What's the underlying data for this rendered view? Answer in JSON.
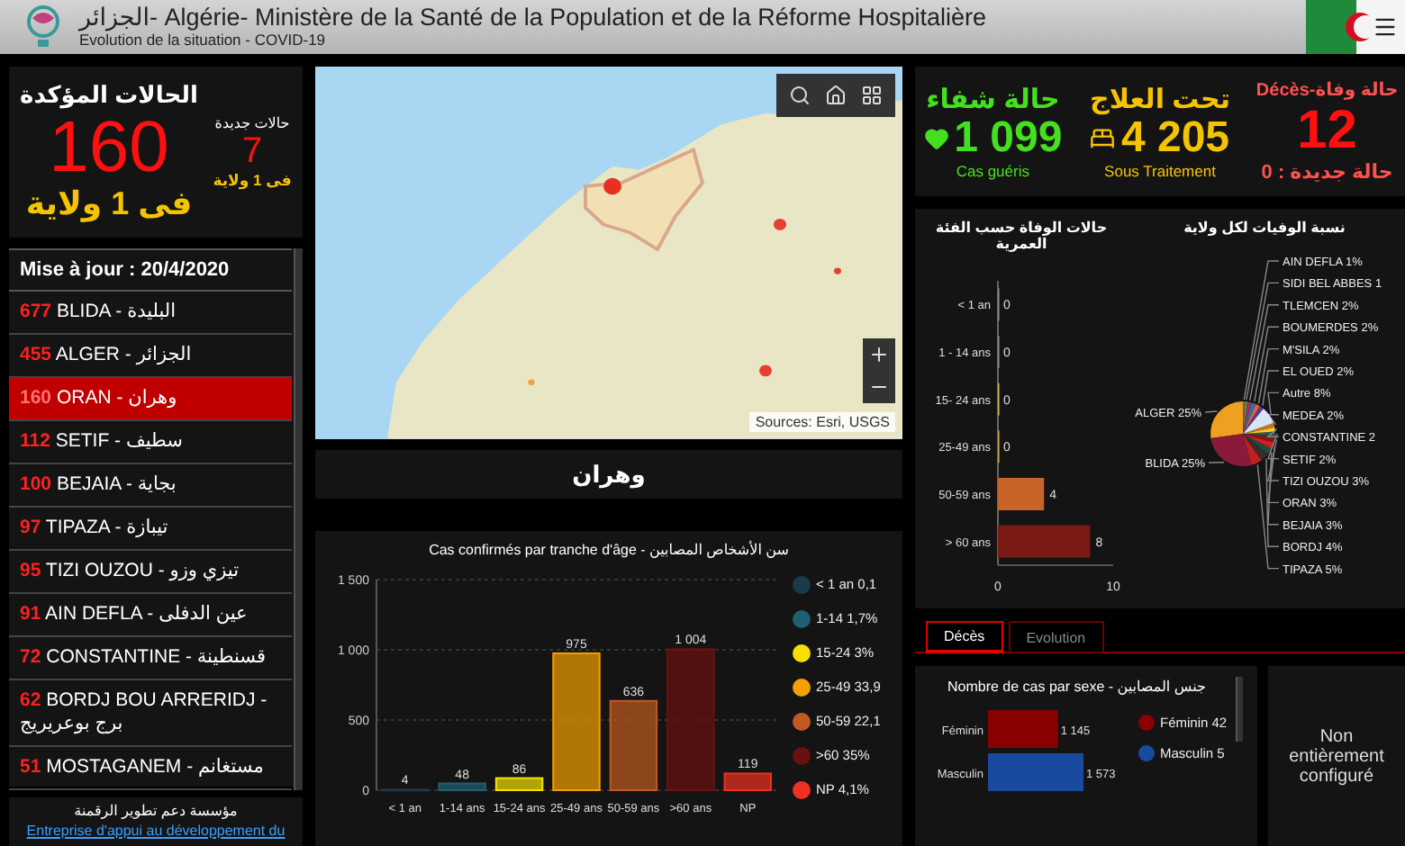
{
  "header": {
    "title": "الجزائر- Algérie- Ministère de la Santé de la Population et de la Réforme Hospitalière",
    "subtitle": "Evolution de la situation - COVID-19"
  },
  "confirmed": {
    "title": "الحالات المؤكدة",
    "value": "160",
    "region": "فى 1 ولاية",
    "new_label": "حالات جديدة",
    "new_value": "7",
    "new_region": "فى 1 ولاية"
  },
  "wilaya_list": {
    "header": "Mise à jour : 20/4/2020",
    "items": [
      {
        "count": "677",
        "name": "BLIDA -",
        "name_ar": "البليدة",
        "selected": false
      },
      {
        "count": "455",
        "name": "ALGER -",
        "name_ar": "الجزائر",
        "selected": false
      },
      {
        "count": "160",
        "name": "ORAN -",
        "name_ar": "وهران",
        "selected": true
      },
      {
        "count": "112",
        "name": "SETIF -",
        "name_ar": "سطيف",
        "selected": false
      },
      {
        "count": "100",
        "name": "BEJAIA -",
        "name_ar": "بجاية",
        "selected": false
      },
      {
        "count": "97",
        "name": "TIPAZA -",
        "name_ar": "تيبازة",
        "selected": false
      },
      {
        "count": "95",
        "name": "TIZI OUZOU -",
        "name_ar": "تيزي وزو",
        "selected": false
      },
      {
        "count": "91",
        "name": "AIN DEFLA -",
        "name_ar": "عين الدفلى",
        "selected": false
      },
      {
        "count": "72",
        "name": "CONSTANTINE -",
        "name_ar": "قسنطينة",
        "selected": false
      },
      {
        "count": "62",
        "name": "BORDJ BOU ARRERIDJ -",
        "name_ar": "برج بوعريريج",
        "selected": false
      },
      {
        "count": "51",
        "name": "MOSTAGANEM -",
        "name_ar": "مستغانم",
        "selected": false
      }
    ]
  },
  "footer": {
    "title": "مؤسسة دعم تطوير الرقمنة",
    "link": "Entreprise d'appui au développement du"
  },
  "map": {
    "source": "Sources: Esri, USGS",
    "caption": "وهران"
  },
  "age_chart": {
    "title": "Cas confirmés par tranche d'âge - سن الأشخاص المصابين",
    "chart_data": {
      "type": "bar",
      "categories": [
        "< 1 an",
        "1-14 ans",
        "15-24 ans",
        "25-49 ans",
        "50-59 ans",
        ">60 ans",
        "NP"
      ],
      "values": [
        4,
        48,
        86,
        975,
        636,
        1004,
        119
      ],
      "ylim": [
        0,
        1500
      ],
      "yticks": [
        0,
        500,
        {
          "value": 1000,
          "label": "1 000"
        },
        {
          "value": 1500,
          "label": "1 500"
        }
      ],
      "value_labels": [
        "4",
        "48",
        "86",
        "975",
        "636",
        "1 004",
        "119"
      ]
    },
    "legend": [
      {
        "label": "< 1 an 0,1",
        "color": "#1b3a4b"
      },
      {
        "label": "1-14 1,7%",
        "color": "#1e6070"
      },
      {
        "label": "15-24 3%",
        "color": "#f5e000"
      },
      {
        "label": "25-49 33,9",
        "color": "#f5a000"
      },
      {
        "label": "50-59 22,1",
        "color": "#c05a20"
      },
      {
        "label": ">60 35%",
        "color": "#6b1010"
      },
      {
        "label": "NP 4,1%",
        "color": "#f03020"
      }
    ]
  },
  "stats": {
    "recovered": {
      "title": "حالة شفاء",
      "value": "1 099",
      "caption": "Cas guéris"
    },
    "treatment": {
      "title": "تحت العلاج",
      "value": "4 205",
      "caption": "Sous Traitement"
    },
    "deaths": {
      "title": "Décès-حالة وفاة",
      "value": "12",
      "caption": "حالة جديدة : 0"
    }
  },
  "death_chart": {
    "title": "حالات الوفاة حسب الفئة العمرية",
    "chart_data": {
      "type": "bar",
      "orientation": "horizontal",
      "categories": [
        "< 1 an",
        "1 - 14 ans",
        "15- 24 ans",
        "25-49 ans",
        "50-59 ans",
        "> 60 ans"
      ],
      "values": [
        0,
        0,
        0,
        0,
        4,
        8
      ],
      "xlim": [
        0,
        10
      ],
      "xticks": [
        0,
        10
      ],
      "data_labels": true
    }
  },
  "pie_chart": {
    "title": "نسبة الوفيات لكل ولاية",
    "chart_data": {
      "type": "pie",
      "categories": [
        "ALGER",
        "BLIDA",
        "TIPAZA",
        "BORDJ",
        "BEJAIA",
        "ORAN",
        "TIZI OUZOU",
        "SETIF",
        "CONSTANTINE",
        "MEDEA",
        "Autre",
        "EL OUED",
        "M'SILA",
        "BOUMERDES",
        "TLEMCEN",
        "SIDI BEL ABBES",
        "AIN DEFLA"
      ],
      "values": [
        25,
        25,
        5,
        4,
        3,
        3,
        3,
        2,
        2,
        2,
        8,
        2,
        2,
        2,
        2,
        1,
        1
      ],
      "value_labels": [
        "25%",
        "25%",
        "5%",
        "4%",
        "3%",
        "3%",
        "3%",
        "2%",
        "2",
        "2%",
        "8%",
        "2%",
        "2%",
        "2%",
        "2%",
        "1",
        "1%"
      ]
    }
  },
  "tabs": [
    {
      "label": "Décès",
      "selected": true
    },
    {
      "label": "Evolution",
      "selected": false
    }
  ],
  "sex_chart": {
    "title": "Nombre de cas par sexe - جنس المصابين",
    "chart_data": {
      "type": "bar",
      "orientation": "horizontal",
      "categories": [
        "Féminin",
        "Masculin"
      ],
      "values": [
        1145,
        1573
      ],
      "value_labels": [
        "1 145",
        "1 573"
      ]
    },
    "legend": [
      {
        "label": "Féminin 42",
        "color": "#8b0000"
      },
      {
        "label": "Masculin 5",
        "color": "#1a4aa0"
      }
    ]
  },
  "unconfigured": {
    "text": "Non entièrement configuré"
  }
}
